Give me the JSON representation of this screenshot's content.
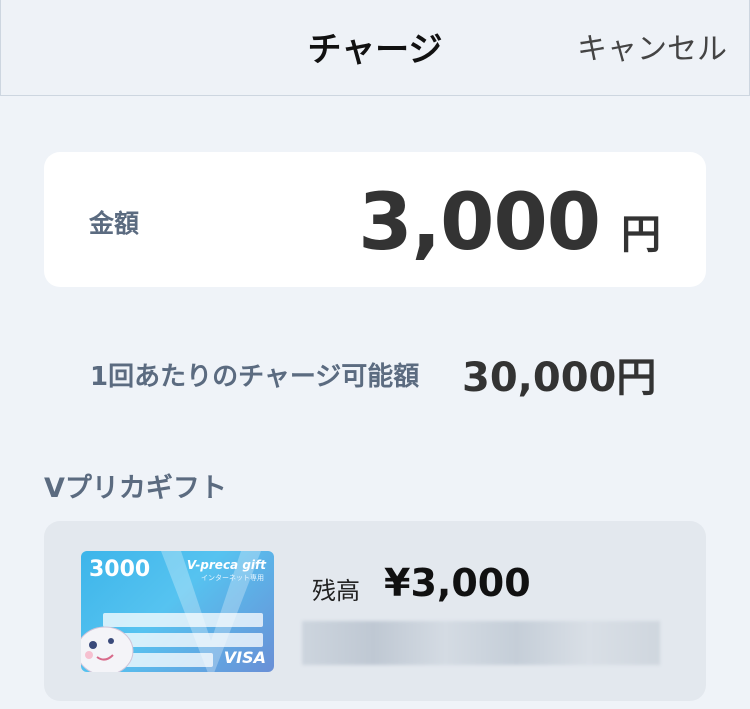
{
  "header": {
    "title": "チャージ",
    "cancel_label": "キャンセル"
  },
  "amount": {
    "label": "金額",
    "value": "3,000",
    "unit": "円"
  },
  "limit": {
    "label": "1回あたりのチャージ可能額",
    "value": "30,000円"
  },
  "section": {
    "title": "Vプリカギフト"
  },
  "card": {
    "face_value": "3000",
    "brand": "V-preca gift",
    "sub_text": "インターネット専用",
    "network": "VISA",
    "balance_label": "残高",
    "balance_value": "¥3,000"
  },
  "colors": {
    "background": "#eff3f8",
    "card_bg": "#ffffff",
    "label": "#5b6b80",
    "gift_bg": "#e3e8ee"
  }
}
